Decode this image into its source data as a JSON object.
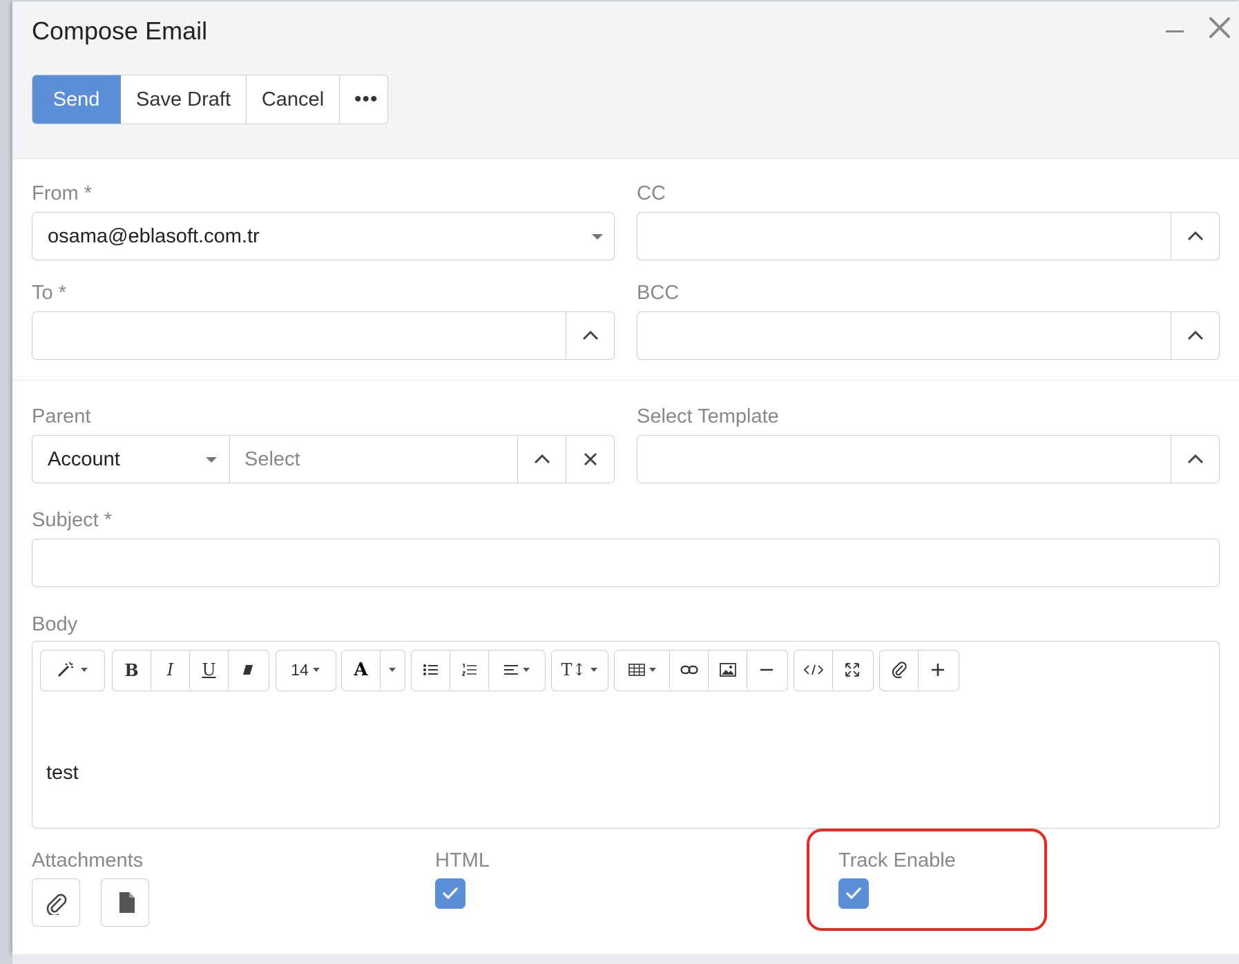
{
  "window": {
    "title": "Compose Email",
    "minimize_icon": "minimize-icon",
    "close_icon": "close-icon"
  },
  "toolbar": {
    "send_label": "Send",
    "save_draft_label": "Save Draft",
    "cancel_label": "Cancel",
    "more_label": "•••"
  },
  "form": {
    "from": {
      "label": "From *",
      "value": "osama@eblasoft.com.tr"
    },
    "cc": {
      "label": "CC",
      "value": ""
    },
    "to": {
      "label": "To *",
      "value": ""
    },
    "bcc": {
      "label": "BCC",
      "value": ""
    },
    "parent": {
      "label": "Parent",
      "type_value": "Account",
      "placeholder": "Select"
    },
    "select_template": {
      "label": "Select Template",
      "value": ""
    },
    "subject": {
      "label": "Subject *",
      "value": ""
    },
    "body": {
      "label": "Body",
      "content": "test",
      "font_size": "14",
      "text_style_label": "T↕",
      "bold": "B",
      "italic": "I",
      "underline": "U",
      "font_color": "A"
    },
    "attachments": {
      "label": "Attachments"
    },
    "html": {
      "label": "HTML",
      "checked": true
    },
    "track_enable": {
      "label": "Track Enable",
      "checked": true
    }
  },
  "colors": {
    "accent": "#5b8fd8",
    "highlight": "#e8291f"
  }
}
